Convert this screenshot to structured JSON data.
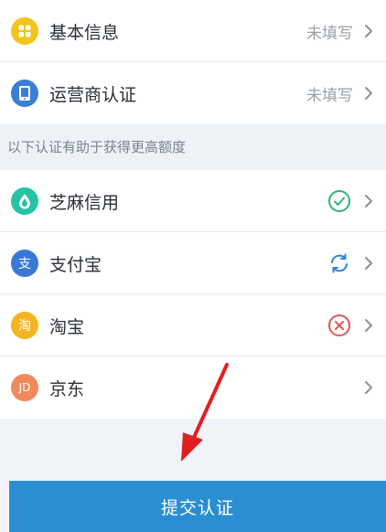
{
  "top_items": [
    {
      "label": "基本信息",
      "status": "未填写",
      "icon": "grid-icon",
      "icon_color": "#f3c419"
    },
    {
      "label": "运营商认证",
      "status": "未填写",
      "icon": "phone-icon",
      "icon_color": "#3a7fd5"
    }
  ],
  "section_header": "以下认证有助于获得更高额度",
  "bottom_items": [
    {
      "label": "芝麻信用",
      "icon": "sesame-icon",
      "icon_color": "#26c2a6",
      "status_icon": "check-circle-icon",
      "status_color": "#2bb673"
    },
    {
      "label": "支付宝",
      "icon": "alipay-icon",
      "icon_color": "#3a78d6",
      "icon_glyph": "支",
      "status_icon": "refresh-icon",
      "status_color": "#2f86d6"
    },
    {
      "label": "淘宝",
      "icon": "taobao-icon",
      "icon_color": "#f5b521",
      "icon_glyph": "淘",
      "status_icon": "x-circle-icon",
      "status_color": "#e25555"
    },
    {
      "label": "京东",
      "icon": "jd-icon",
      "icon_color": "#f08a5d",
      "icon_glyph": "JD"
    }
  ],
  "submit_label": "提交认证",
  "colors": {
    "submit": "#2a8fd2",
    "annotation_arrow": "#e02020"
  }
}
